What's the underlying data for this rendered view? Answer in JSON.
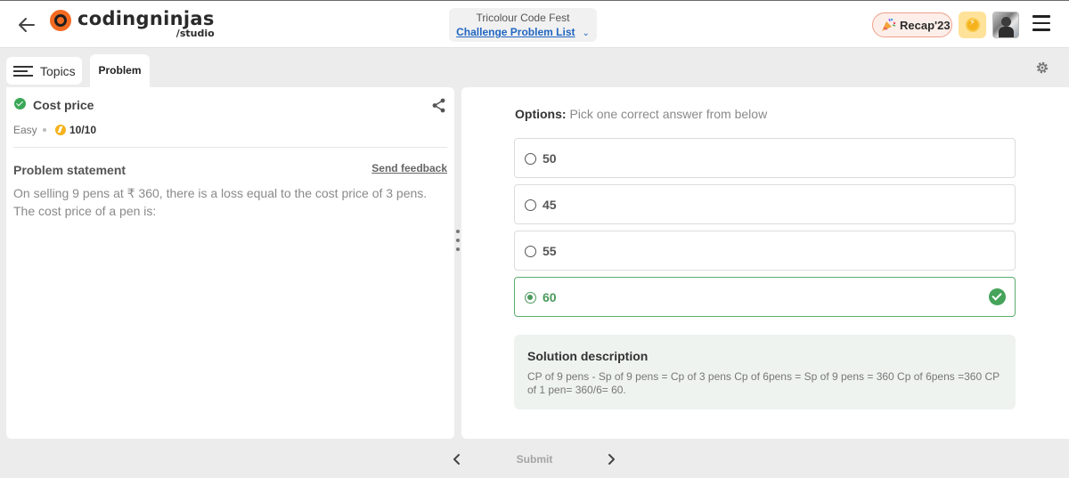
{
  "header": {
    "logo_text": "codingninjas",
    "logo_sub": "/studio",
    "event_title": "Tricolour Code Fest",
    "event_link": "Challenge Problem List",
    "recap_label": "Recap'23"
  },
  "tabs": {
    "topics": "Topics",
    "problem": "Problem"
  },
  "problem": {
    "title": "Cost price",
    "difficulty": "Easy",
    "score": "10/10",
    "statement_heading": "Problem statement",
    "feedback_label": "Send feedback",
    "statement": "On selling 9 pens at ₹ 360, there is a loss equal to the cost price of 3 pens. The cost price of a pen is:"
  },
  "answer": {
    "options_label": "Options:",
    "options_hint": "Pick one correct answer from below",
    "options": [
      {
        "label": "50",
        "selected": false
      },
      {
        "label": "45",
        "selected": false
      },
      {
        "label": "55",
        "selected": false
      },
      {
        "label": "60",
        "selected": true,
        "correct": true
      }
    ],
    "solution_heading": "Solution description",
    "solution_text": "CP of 9 pens - Sp of 9 pens = Cp of 3 pens Cp of 6pens = Sp of 9 pens = 360 Cp of 6pens =360 CP of 1 pen= 360/6= 60."
  },
  "footer": {
    "submit_label": "Submit"
  },
  "colors": {
    "brand_orange": "#f26b21",
    "link_blue": "#2166c2",
    "correct_green": "#45a35a",
    "coin_yellow": "#f5b21c"
  }
}
